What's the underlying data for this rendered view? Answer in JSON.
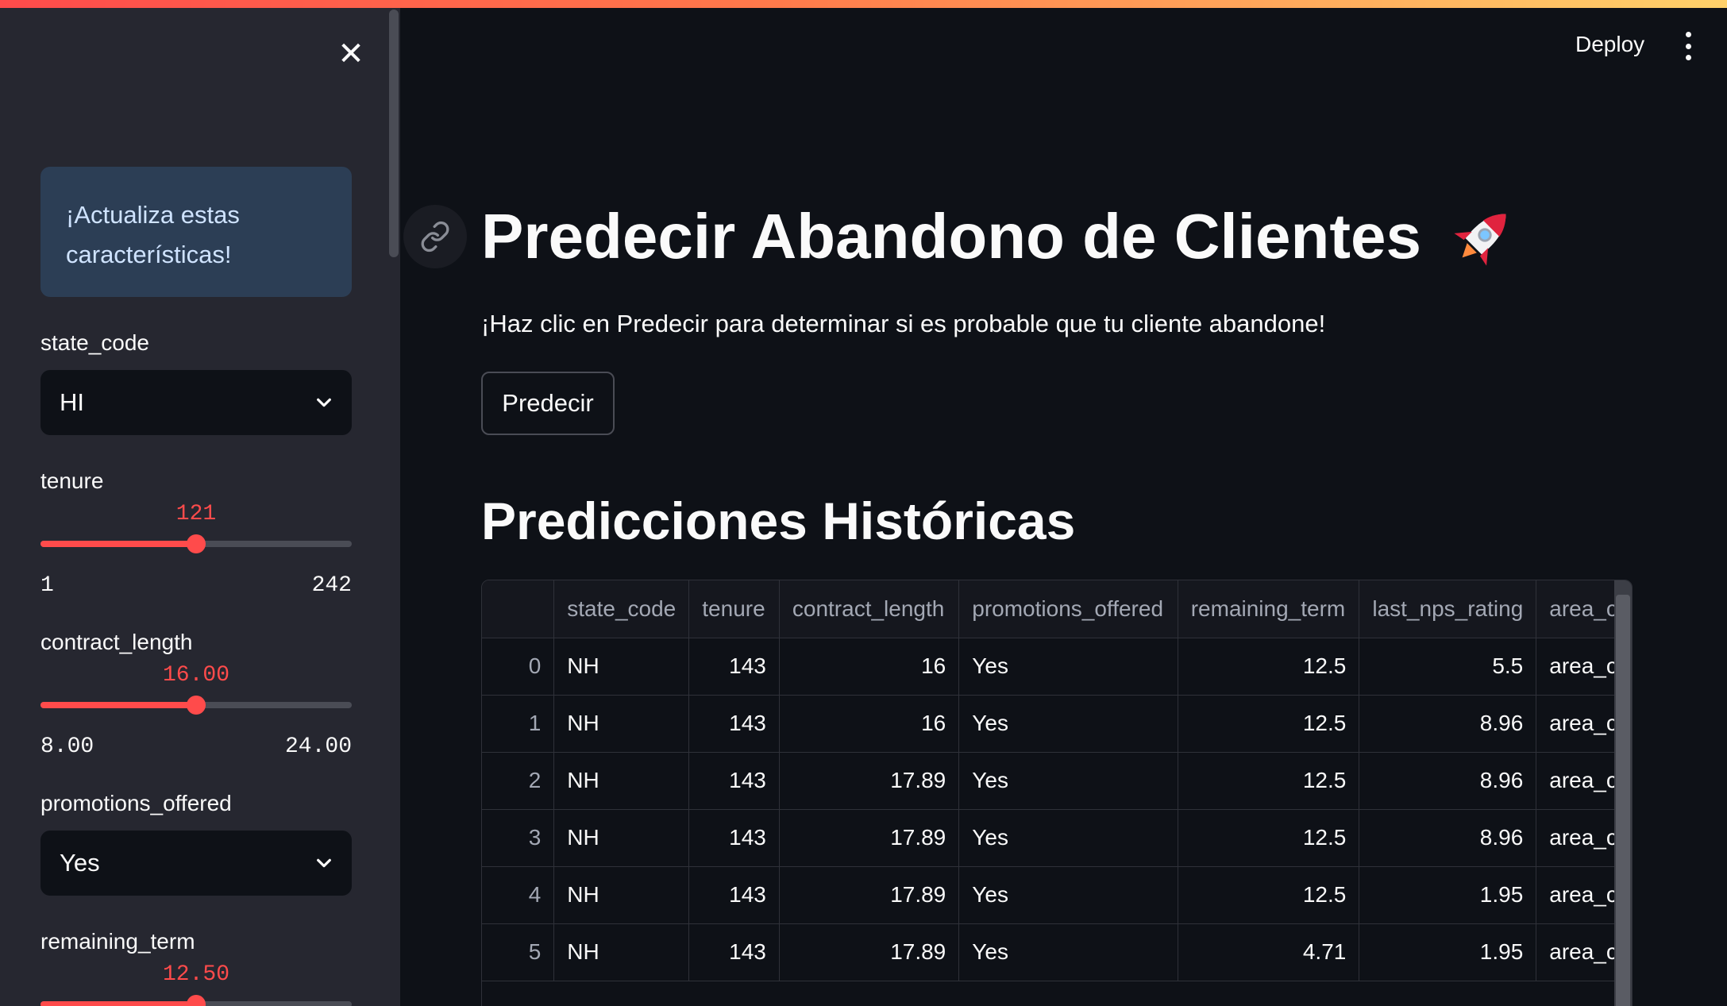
{
  "sidebar": {
    "info": "¡Actualiza estas características!",
    "fields": {
      "state_code": {
        "label": "state_code",
        "value": "HI"
      },
      "tenure": {
        "label": "tenure",
        "value": "121",
        "min": "1",
        "max": "242",
        "fraction": 0.5
      },
      "contract_length": {
        "label": "contract_length",
        "value": "16.00",
        "min": "8.00",
        "max": "24.00",
        "fraction": 0.5
      },
      "promotions_offered": {
        "label": "promotions_offered",
        "value": "Yes"
      },
      "remaining_term": {
        "label": "remaining_term",
        "value": "12.50",
        "fraction": 0.5
      }
    }
  },
  "header": {
    "deploy_label": "Deploy"
  },
  "main": {
    "title": "Predecir Abandono de Clientes",
    "subtitle": "¡Haz clic en Predecir para determinar si es probable que tu cliente abandone!",
    "predict_label": "Predecir",
    "history_title": "Predicciones Históricas",
    "table": {
      "columns": [
        "",
        "state_code",
        "tenure",
        "contract_length",
        "promotions_offered",
        "remaining_term",
        "last_nps_rating",
        "area_c"
      ],
      "rows": [
        [
          "0",
          "NH",
          "143",
          "16",
          "Yes",
          "12.5",
          "5.5",
          "area_c"
        ],
        [
          "1",
          "NH",
          "143",
          "16",
          "Yes",
          "12.5",
          "8.96",
          "area_c"
        ],
        [
          "2",
          "NH",
          "143",
          "17.89",
          "Yes",
          "12.5",
          "8.96",
          "area_c"
        ],
        [
          "3",
          "NH",
          "143",
          "17.89",
          "Yes",
          "12.5",
          "8.96",
          "area_c"
        ],
        [
          "4",
          "NH",
          "143",
          "17.89",
          "Yes",
          "12.5",
          "1.95",
          "area_c"
        ],
        [
          "5",
          "NH",
          "143",
          "17.89",
          "Yes",
          "4.71",
          "1.95",
          "area_c"
        ]
      ]
    }
  },
  "colors": {
    "accent": "#ff4b4b",
    "background": "#0e1117",
    "sidebar": "#262730",
    "info_bg": "#2c3e55"
  }
}
